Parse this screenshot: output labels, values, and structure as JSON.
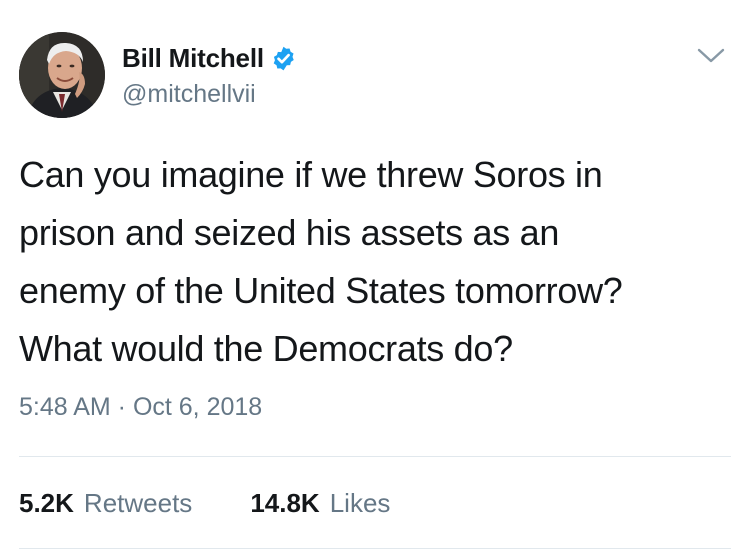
{
  "author": {
    "display_name": "Bill Mitchell",
    "handle": "@mitchellvii",
    "verified": true,
    "avatar_icon": "profile-photo"
  },
  "tweet": {
    "lines": [
      "Can you imagine if we threw Soros in",
      "prison and seized his assets as an",
      "enemy of the United States tomorrow?",
      "What would the Democrats do?"
    ],
    "timestamp": "5:48 AM · Oct 6, 2018"
  },
  "stats": {
    "retweets_count": "5.2K",
    "retweets_label": "Retweets",
    "likes_count": "14.8K",
    "likes_label": "Likes"
  },
  "icons": {
    "verified": "verified-badge-icon",
    "more": "chevron-down-icon"
  },
  "colors": {
    "text": "#14171a",
    "secondary": "#657786",
    "verified_blue": "#1da1f2",
    "divider": "#e1e8ed"
  }
}
